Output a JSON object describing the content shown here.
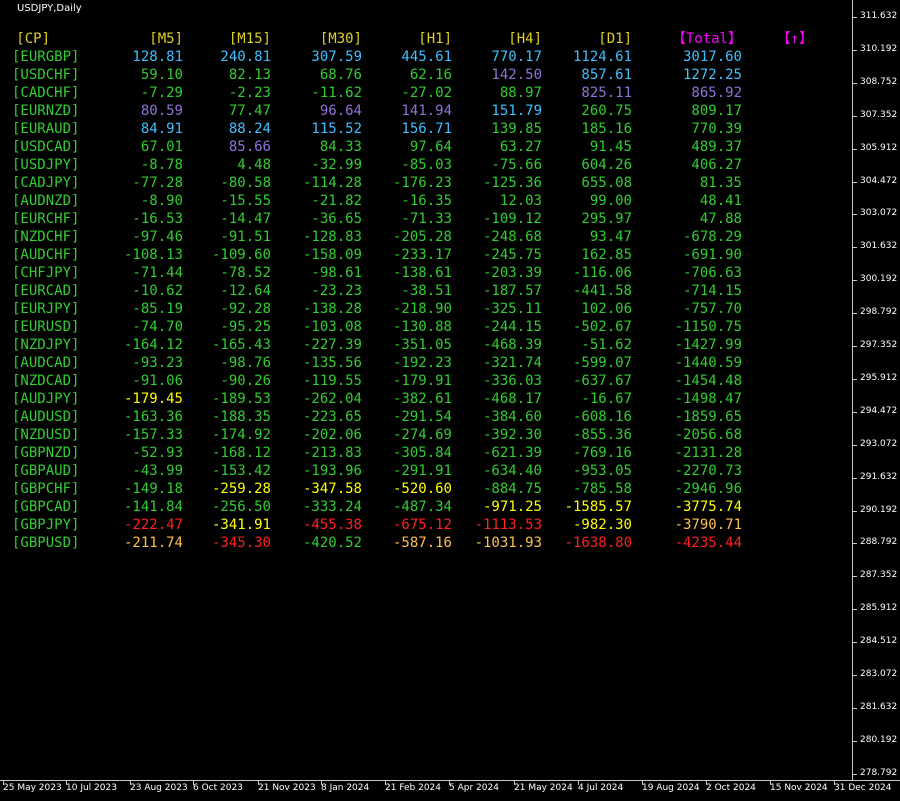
{
  "window": {
    "title": "USDJPY,Daily"
  },
  "colors": {
    "header_cp": "#e0d020",
    "header_tf": "#e0d020",
    "header_total": "#ff00ff",
    "header_arrow": "#ff00ff",
    "pair": "#32cd32",
    "lime": "#32cd32",
    "aqua": "#40bfff",
    "purple": "#9370db",
    "yellow": "#ffff00",
    "orange": "#ffc050",
    "red": "#ff2020"
  },
  "table": {
    "headers": {
      "cp": "[CP]",
      "m5": "[M5]",
      "m15": "[M15]",
      "m30": "[M30]",
      "h1": "[H1]",
      "h4": "[H4]",
      "d1": "[D1]",
      "total": "【Total】",
      "arrow": "【↑】"
    },
    "rows": [
      {
        "pair": "[EURGBP]",
        "values": [
          "128.81",
          "240.81",
          "307.59",
          "445.61",
          "770.17",
          "1124.61",
          "3017.60"
        ],
        "colors": [
          "aqua",
          "aqua",
          "aqua",
          "aqua",
          "aqua",
          "aqua",
          "aqua"
        ]
      },
      {
        "pair": "[USDCHF]",
        "values": [
          "59.10",
          "82.13",
          "68.76",
          "62.16",
          "142.50",
          "857.61",
          "1272.25"
        ],
        "colors": [
          "lime",
          "lime",
          "lime",
          "lime",
          "purple",
          "aqua",
          "aqua"
        ]
      },
      {
        "pair": "[CADCHF]",
        "values": [
          "-7.29",
          "-2.23",
          "-11.62",
          "-27.02",
          "88.97",
          "825.11",
          "865.92"
        ],
        "colors": [
          "lime",
          "lime",
          "lime",
          "lime",
          "lime",
          "purple",
          "purple"
        ]
      },
      {
        "pair": "[EURNZD]",
        "values": [
          "80.59",
          "77.47",
          "96.64",
          "141.94",
          "151.79",
          "260.75",
          "809.17"
        ],
        "colors": [
          "purple",
          "lime",
          "purple",
          "purple",
          "aqua",
          "lime",
          "lime"
        ]
      },
      {
        "pair": "[EURAUD]",
        "values": [
          "84.91",
          "88.24",
          "115.52",
          "156.71",
          "139.85",
          "185.16",
          "770.39"
        ],
        "colors": [
          "aqua",
          "aqua",
          "aqua",
          "aqua",
          "lime",
          "lime",
          "lime"
        ]
      },
      {
        "pair": "[USDCAD]",
        "values": [
          "67.01",
          "85.66",
          "84.33",
          "97.64",
          "63.27",
          "91.45",
          "489.37"
        ],
        "colors": [
          "lime",
          "purple",
          "lime",
          "lime",
          "lime",
          "lime",
          "lime"
        ]
      },
      {
        "pair": "[USDJPY]",
        "values": [
          "-8.78",
          "4.48",
          "-32.99",
          "-85.03",
          "-75.66",
          "604.26",
          "406.27"
        ],
        "colors": [
          "lime",
          "lime",
          "lime",
          "lime",
          "lime",
          "lime",
          "lime"
        ]
      },
      {
        "pair": "[CADJPY]",
        "values": [
          "-77.28",
          "-80.58",
          "-114.28",
          "-176.23",
          "-125.36",
          "655.08",
          "81.35"
        ],
        "colors": [
          "lime",
          "lime",
          "lime",
          "lime",
          "lime",
          "lime",
          "lime"
        ]
      },
      {
        "pair": "[AUDNZD]",
        "values": [
          "-8.90",
          "-15.55",
          "-21.82",
          "-16.35",
          "12.03",
          "99.00",
          "48.41"
        ],
        "colors": [
          "lime",
          "lime",
          "lime",
          "lime",
          "lime",
          "lime",
          "lime"
        ]
      },
      {
        "pair": "[EURCHF]",
        "values": [
          "-16.53",
          "-14.47",
          "-36.65",
          "-71.33",
          "-109.12",
          "295.97",
          "47.88"
        ],
        "colors": [
          "lime",
          "lime",
          "lime",
          "lime",
          "lime",
          "lime",
          "lime"
        ]
      },
      {
        "pair": "[NZDCHF]",
        "values": [
          "-97.46",
          "-91.51",
          "-128.83",
          "-205.28",
          "-248.68",
          "93.47",
          "-678.29"
        ],
        "colors": [
          "lime",
          "lime",
          "lime",
          "lime",
          "lime",
          "lime",
          "lime"
        ]
      },
      {
        "pair": "[AUDCHF]",
        "values": [
          "-108.13",
          "-109.60",
          "-158.09",
          "-233.17",
          "-245.75",
          "162.85",
          "-691.90"
        ],
        "colors": [
          "lime",
          "lime",
          "lime",
          "lime",
          "lime",
          "lime",
          "lime"
        ]
      },
      {
        "pair": "[CHFJPY]",
        "values": [
          "-71.44",
          "-78.52",
          "-98.61",
          "-138.61",
          "-203.39",
          "-116.06",
          "-706.63"
        ],
        "colors": [
          "lime",
          "lime",
          "lime",
          "lime",
          "lime",
          "lime",
          "lime"
        ]
      },
      {
        "pair": "[EURCAD]",
        "values": [
          "-10.62",
          "-12.64",
          "-23.23",
          "-38.51",
          "-187.57",
          "-441.58",
          "-714.15"
        ],
        "colors": [
          "lime",
          "lime",
          "lime",
          "lime",
          "lime",
          "lime",
          "lime"
        ]
      },
      {
        "pair": "[EURJPY]",
        "values": [
          "-85.19",
          "-92.28",
          "-138.28",
          "-218.90",
          "-325.11",
          "102.06",
          "-757.70"
        ],
        "colors": [
          "lime",
          "lime",
          "lime",
          "lime",
          "lime",
          "lime",
          "lime"
        ]
      },
      {
        "pair": "[EURUSD]",
        "values": [
          "-74.70",
          "-95.25",
          "-103.08",
          "-130.88",
          "-244.15",
          "-502.67",
          "-1150.75"
        ],
        "colors": [
          "lime",
          "lime",
          "lime",
          "lime",
          "lime",
          "lime",
          "lime"
        ]
      },
      {
        "pair": "[NZDJPY]",
        "values": [
          "-164.12",
          "-165.43",
          "-227.39",
          "-351.05",
          "-468.39",
          "-51.62",
          "-1427.99"
        ],
        "colors": [
          "lime",
          "lime",
          "lime",
          "lime",
          "lime",
          "lime",
          "lime"
        ]
      },
      {
        "pair": "[AUDCAD]",
        "values": [
          "-93.23",
          "-98.76",
          "-135.56",
          "-192.23",
          "-321.74",
          "-599.07",
          "-1440.59"
        ],
        "colors": [
          "lime",
          "lime",
          "lime",
          "lime",
          "lime",
          "lime",
          "lime"
        ]
      },
      {
        "pair": "[NZDCAD]",
        "values": [
          "-91.06",
          "-90.26",
          "-119.55",
          "-179.91",
          "-336.03",
          "-637.67",
          "-1454.48"
        ],
        "colors": [
          "lime",
          "lime",
          "lime",
          "lime",
          "lime",
          "lime",
          "lime"
        ]
      },
      {
        "pair": "[AUDJPY]",
        "values": [
          "-179.45",
          "-189.53",
          "-262.04",
          "-382.61",
          "-468.17",
          "-16.67",
          "-1498.47"
        ],
        "colors": [
          "yellow",
          "lime",
          "lime",
          "lime",
          "lime",
          "lime",
          "lime"
        ]
      },
      {
        "pair": "[AUDUSD]",
        "values": [
          "-163.36",
          "-188.35",
          "-223.65",
          "-291.54",
          "-384.60",
          "-608.16",
          "-1859.65"
        ],
        "colors": [
          "lime",
          "lime",
          "lime",
          "lime",
          "lime",
          "lime",
          "lime"
        ]
      },
      {
        "pair": "[NZDUSD]",
        "values": [
          "-157.33",
          "-174.92",
          "-202.06",
          "-274.69",
          "-392.30",
          "-855.36",
          "-2056.68"
        ],
        "colors": [
          "lime",
          "lime",
          "lime",
          "lime",
          "lime",
          "lime",
          "lime"
        ]
      },
      {
        "pair": "[GBPNZD]",
        "values": [
          "-52.93",
          "-168.12",
          "-213.83",
          "-305.84",
          "-621.39",
          "-769.16",
          "-2131.28"
        ],
        "colors": [
          "lime",
          "lime",
          "lime",
          "lime",
          "lime",
          "lime",
          "lime"
        ]
      },
      {
        "pair": "[GBPAUD]",
        "values": [
          "-43.99",
          "-153.42",
          "-193.96",
          "-291.91",
          "-634.40",
          "-953.05",
          "-2270.73"
        ],
        "colors": [
          "lime",
          "lime",
          "lime",
          "lime",
          "lime",
          "lime",
          "lime"
        ]
      },
      {
        "pair": "[GBPCHF]",
        "values": [
          "-149.18",
          "-259.28",
          "-347.58",
          "-520.60",
          "-884.75",
          "-785.58",
          "-2946.96"
        ],
        "colors": [
          "lime",
          "yellow",
          "yellow",
          "yellow",
          "lime",
          "lime",
          "lime"
        ]
      },
      {
        "pair": "[GBPCAD]",
        "values": [
          "-141.84",
          "-256.50",
          "-333.24",
          "-487.34",
          "-971.25",
          "-1585.57",
          "-3775.74"
        ],
        "colors": [
          "lime",
          "lime",
          "lime",
          "lime",
          "yellow",
          "yellow",
          "yellow"
        ]
      },
      {
        "pair": "[GBPJPY]",
        "values": [
          "-222.47",
          "-341.91",
          "-455.38",
          "-675.12",
          "-1113.53",
          "-982.30",
          "-3790.71"
        ],
        "colors": [
          "red",
          "yellow",
          "red",
          "red",
          "red",
          "yellow",
          "orange"
        ]
      },
      {
        "pair": "[GBPUSD]",
        "values": [
          "-211.74",
          "-345.30",
          "-420.52",
          "-587.16",
          "-1031.93",
          "-1638.80",
          "-4235.44"
        ],
        "colors": [
          "orange",
          "red",
          "lime",
          "orange",
          "orange",
          "red",
          "red"
        ]
      }
    ]
  },
  "price_axis": [
    "311.632",
    "310.192",
    "308.752",
    "307.352",
    "305.912",
    "304.472",
    "303.072",
    "301.632",
    "300.192",
    "298.792",
    "297.352",
    "295.912",
    "294.472",
    "293.072",
    "291.632",
    "290.192",
    "288.792",
    "287.352",
    "285.912",
    "284.512",
    "283.072",
    "281.632",
    "280.192",
    "278.792"
  ],
  "date_axis": [
    "25 May 2023",
    "10 Jul 2023",
    "23 Aug 2023",
    "6 Oct 2023",
    "21 Nov 2023",
    "8 Jan 2024",
    "21 Feb 2024",
    "5 Apr 2024",
    "21 May 2024",
    "4 Jul 2024",
    "19 Aug 2024",
    "2 Oct 2024",
    "15 Nov 2024",
    "31 Dec 2024"
  ]
}
